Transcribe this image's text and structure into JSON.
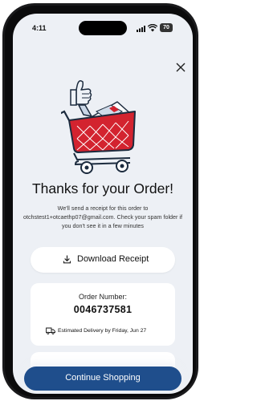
{
  "status_bar": {
    "time": "4:11",
    "battery": "70"
  },
  "content": {
    "title": "Thanks for your Order!",
    "message": "We'll send a receipt for this order to otchstest1+otcaethp07@gmail.com. Check your spam folder if you don't see it in a few minutes"
  },
  "download": {
    "label": "Download Receipt"
  },
  "order": {
    "number_label": "Order Number:",
    "number": "0046737581",
    "delivery": "Estimated Delivery by Friday, Jun 27"
  },
  "cta": {
    "label": "Continue Shopping"
  },
  "colors": {
    "primary": "#1f4e8c",
    "cart_red": "#d3232f",
    "background": "#edf0f5"
  },
  "icons": [
    "close-icon",
    "download-icon",
    "truck-icon",
    "shopping-cart-illustration"
  ]
}
